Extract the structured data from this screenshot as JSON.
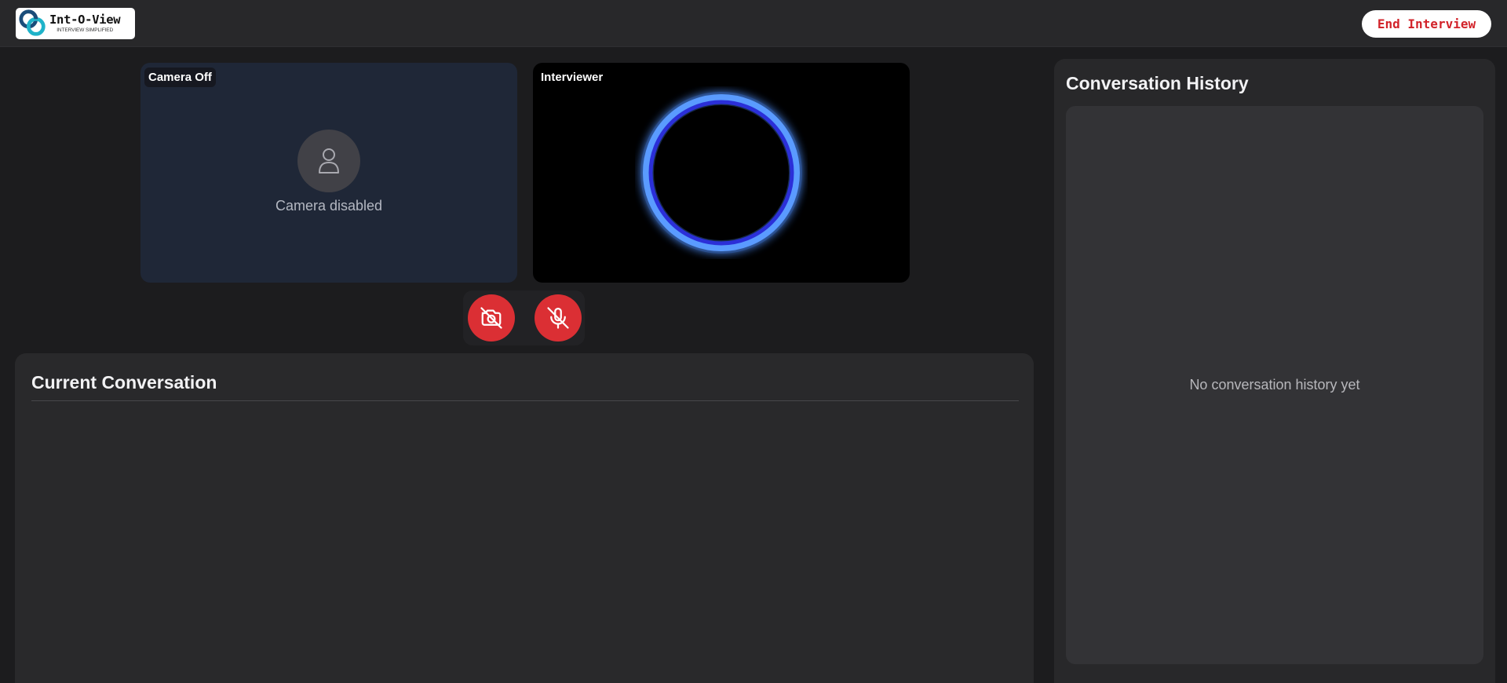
{
  "header": {
    "logo": {
      "name": "Int-O-View",
      "tagline": "INTERVIEW SIMPLIFIED"
    },
    "end_button_label": "End Interview"
  },
  "video": {
    "user_tile": {
      "label": "Camera Off",
      "status_text": "Camera disabled",
      "icon": "user-icon"
    },
    "ai_tile": {
      "label": "Interviewer",
      "visual": "glowing-ring"
    }
  },
  "controls": {
    "camera_button": {
      "icon": "camera-off-icon",
      "state": "off"
    },
    "mic_button": {
      "icon": "mic-off-icon",
      "state": "muted"
    }
  },
  "current_conversation": {
    "title": "Current Conversation"
  },
  "history": {
    "title": "Conversation History",
    "empty_text": "No conversation history yet"
  },
  "colors": {
    "background": "#1c1c1e",
    "panel": "#29292b",
    "danger": "#db2f34",
    "end_text": "#d2232a",
    "ring": "#3b7bff"
  }
}
